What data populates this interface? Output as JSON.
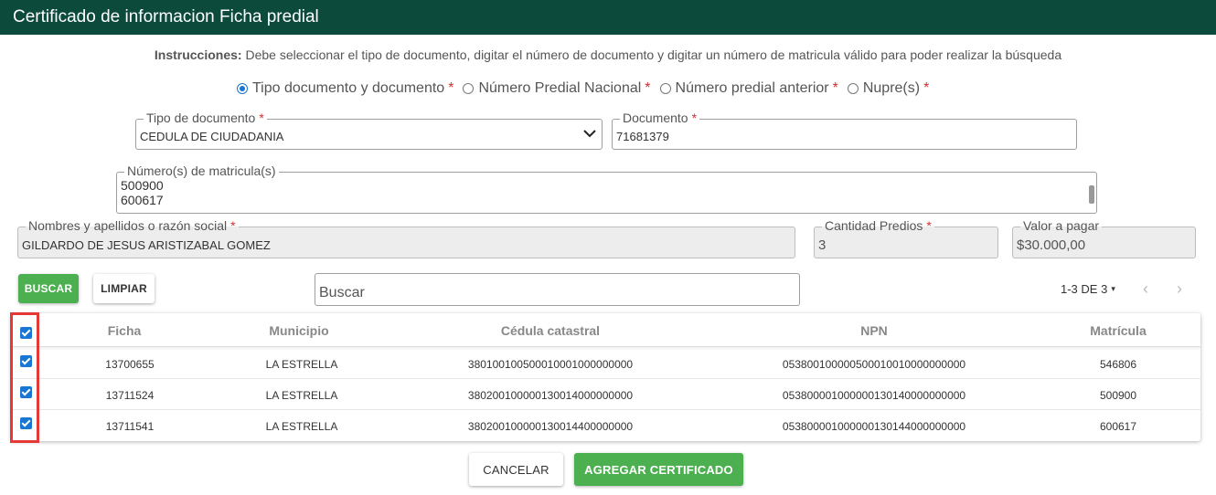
{
  "header": {
    "title": "Certificado de informacion Ficha predial"
  },
  "instructions": {
    "label": "Instrucciones:",
    "text": "Debe seleccionar el tipo de documento, digitar el número de documento y digitar un número de matricula válido para poder realizar la búsqueda"
  },
  "search_mode": {
    "required_mark": "*",
    "options": [
      {
        "label": "Tipo documento y documento",
        "checked": true
      },
      {
        "label": "Número Predial Nacional",
        "checked": false
      },
      {
        "label": "Número predial anterior",
        "checked": false
      },
      {
        "label": "Nupre(s)",
        "checked": false
      }
    ]
  },
  "form": {
    "tipo_documento": {
      "label": "Tipo de documento",
      "value": "CEDULA DE CIUDADANIA"
    },
    "documento": {
      "label": "Documento",
      "value": "71681379"
    },
    "matriculas": {
      "label": "Número(s) de matricula(s)",
      "lines": [
        "500900",
        "600617"
      ]
    },
    "nombres": {
      "label": "Nombres y apellidos o razón social",
      "value": "GILDARDO DE JESUS ARISTIZABAL GOMEZ"
    },
    "cantidad_predios": {
      "label": "Cantidad Predios",
      "value": "3"
    },
    "valor_pagar": {
      "label": "Valor a pagar",
      "value": "$30.000,00"
    }
  },
  "actions": {
    "buscar": "BUSCAR",
    "limpiar": "LIMPIAR"
  },
  "table_search": {
    "placeholder": "Buscar"
  },
  "pagination": {
    "text": "1-3 DE 3",
    "caret": "▾"
  },
  "table": {
    "columns": [
      "Ficha",
      "Municipio",
      "Cédula catastral",
      "NPN",
      "Matrícula"
    ],
    "rows": [
      {
        "ficha": "13700655",
        "municipio": "LA ESTRELLA",
        "cedula": "380100100500010001000000000",
        "npn": "053800100000500010010000000000",
        "matricula": "546806",
        "checked": true
      },
      {
        "ficha": "13711524",
        "municipio": "LA ESTRELLA",
        "cedula": "380200100000130014000000000",
        "npn": "053800001000000130140000000000",
        "matricula": "500900",
        "checked": true
      },
      {
        "ficha": "13711541",
        "municipio": "LA ESTRELLA",
        "cedula": "380200100000130014400000000",
        "npn": "053800001000000130144000000000",
        "matricula": "600617",
        "checked": true
      }
    ]
  },
  "footer": {
    "cancelar": "CANCELAR",
    "agregar": "AGREGAR CERTIFICADO"
  },
  "colors": {
    "header": "#0c4a3c",
    "accent_green": "#4caf50",
    "checkbox_blue": "#1976d2",
    "highlight_red": "#e53935"
  }
}
